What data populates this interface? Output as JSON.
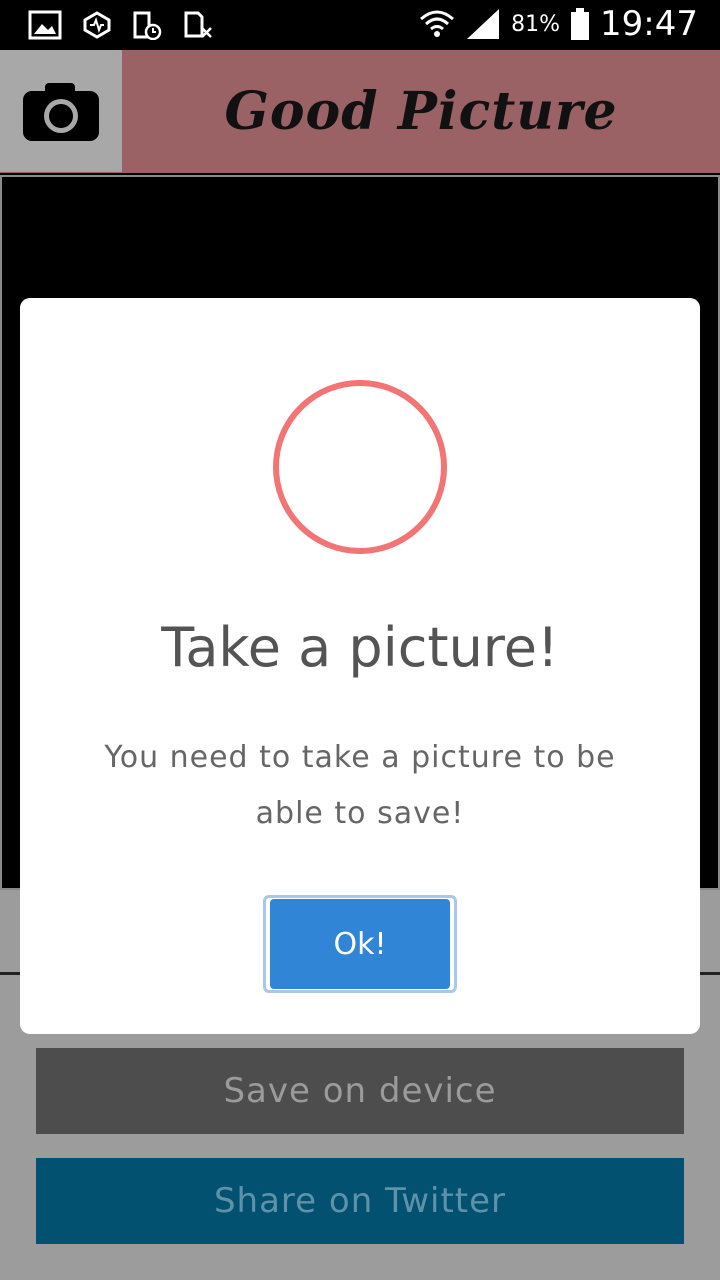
{
  "status_bar": {
    "icons_left": [
      "gallery-icon",
      "data-saver-icon",
      "phone-clock-icon",
      "sim-off-icon"
    ],
    "icons_right": [
      "wifi-icon",
      "signal-icon",
      "battery-icon"
    ],
    "battery_percent": "81%",
    "time": "19:47"
  },
  "header": {
    "camera_icon": "camera-icon",
    "title": "Good Picture",
    "bg_color": "#9a6265"
  },
  "actions": {
    "save_label": "Save on device",
    "twitter_label": "Share on Twitter"
  },
  "modal": {
    "icon": "circle-icon",
    "icon_color": "#f27474",
    "title": "Take a picture!",
    "text": "You need to take a picture to be able to save!",
    "ok_label": "Ok!",
    "ok_color": "#3085d6"
  }
}
